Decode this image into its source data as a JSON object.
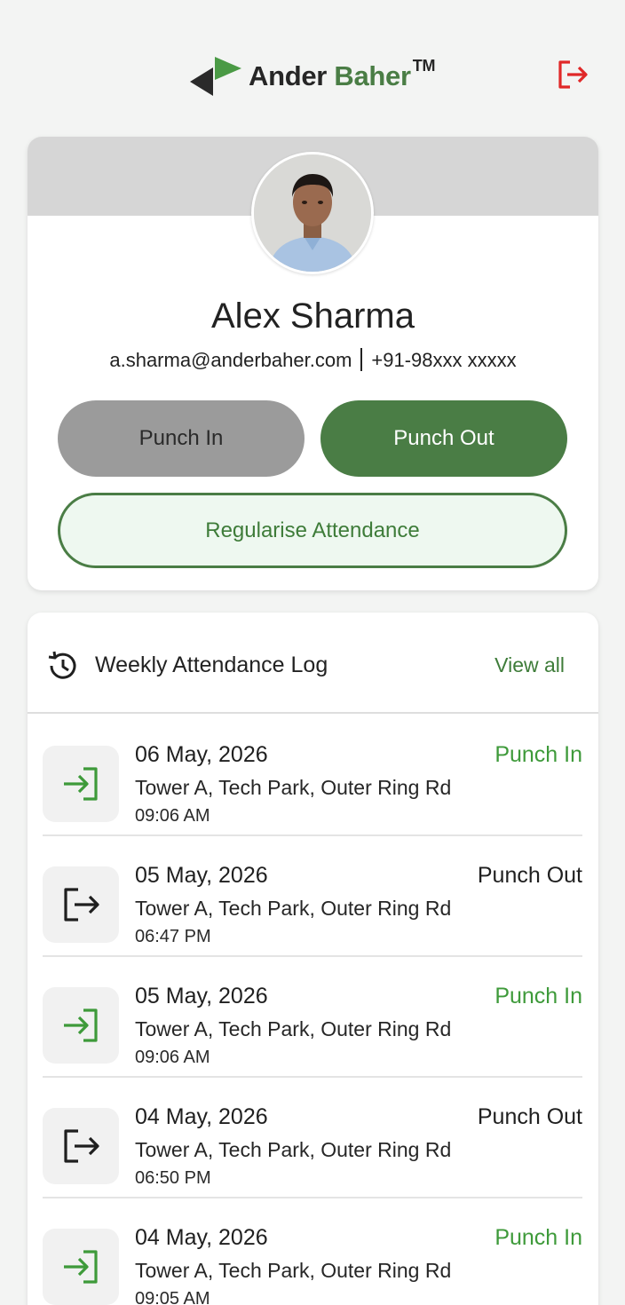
{
  "brand": {
    "name_part1": "Ander ",
    "name_part2": "Baher",
    "trademark": "TM"
  },
  "header": {
    "logout_icon": "logout-icon",
    "logout_color": "#e02828"
  },
  "profile": {
    "name": "Alex Sharma",
    "email": "a.sharma@anderbaher.com",
    "phone": "+91-98xxx xxxxx",
    "avatar_icon": "user-avatar"
  },
  "actions": {
    "punch_in_label": "Punch In",
    "punch_out_label": "Punch Out",
    "regularise_label": "Regularise Attendance"
  },
  "log": {
    "title": "Weekly Attendance Log",
    "view_all_label": "View all",
    "entries": [
      {
        "date": "06 May, 2026",
        "location": "Tower A, Tech Park, Outer Ring Rd",
        "time": "09:06 AM",
        "type": "Punch In",
        "icon": "login-icon"
      },
      {
        "date": "05 May, 2026",
        "location": "Tower A, Tech Park, Outer Ring Rd",
        "time": "06:47 PM",
        "type": "Punch Out",
        "icon": "logout-icon"
      },
      {
        "date": "05 May, 2026",
        "location": "Tower A, Tech Park, Outer Ring Rd",
        "time": "09:06 AM",
        "type": "Punch In",
        "icon": "login-icon"
      },
      {
        "date": "04 May, 2026",
        "location": "Tower A, Tech Park, Outer Ring Rd",
        "time": "06:50 PM",
        "type": "Punch Out",
        "icon": "logout-icon"
      },
      {
        "date": "04 May, 2026",
        "location": "Tower A, Tech Park, Outer Ring Rd",
        "time": "09:05 AM",
        "type": "Punch In",
        "icon": "login-icon"
      }
    ]
  },
  "colors": {
    "brand_green": "#4a7d45",
    "punch_in_green": "#3e9a3a",
    "banner_gray": "#d6d6d6"
  }
}
